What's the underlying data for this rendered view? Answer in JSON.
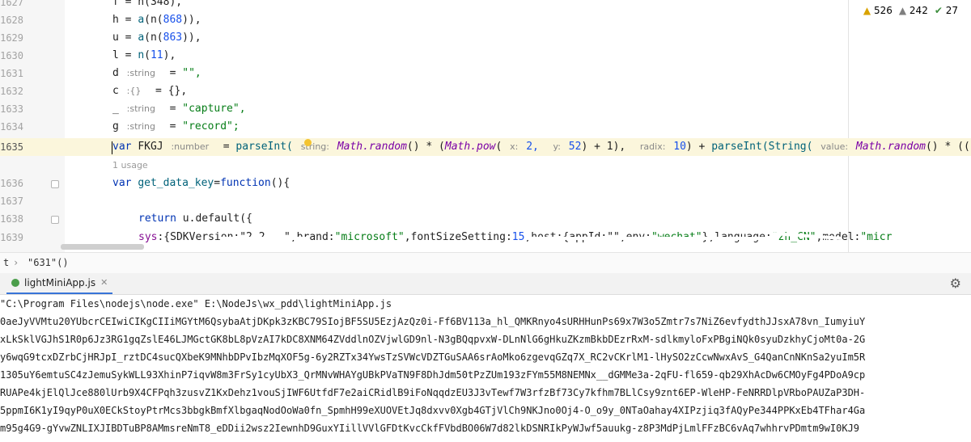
{
  "editor": {
    "lines": {
      "l1627": {
        "num": "1627",
        "text": "f = n(348),"
      },
      "l1628": {
        "num": "1628",
        "var": "h",
        "call": "a",
        "arg": "868"
      },
      "l1629": {
        "num": "1629",
        "var": "u",
        "call": "a",
        "arg": "863"
      },
      "l1630": {
        "num": "1630",
        "var": "l",
        "call": "n",
        "arg": "11"
      },
      "l1631": {
        "num": "1631",
        "var": "d",
        "hint": "string",
        "value": "\"\","
      },
      "l1632": {
        "num": "1632",
        "var": "c",
        "hint": "{}",
        "value": "{},"
      },
      "l1633": {
        "num": "1633",
        "var": "_",
        "hint": "string",
        "value": "\"capture\","
      },
      "l1634": {
        "num": "1634",
        "var": "g",
        "hint": "string",
        "value": "\"record\";"
      },
      "l1635": {
        "num": "1635",
        "kw": "var",
        "name": "FKGJ",
        "hint": "number",
        "fn_parse": "parseInt(",
        "hint_string": "string:",
        "math_random": "Math.random",
        "paren_mul": "() * (",
        "math_pow": "Math.pow",
        "open": "(",
        "hint_x": "x:",
        "x_val": "2,",
        "hint_y": "y:",
        "y_val": "52",
        "tail1": ") + 1),",
        "hint_radix": "radix:",
        "radix_val": "10",
        "tail2": ") + ",
        "fn_parse2": "parseInt(",
        "fn_string": "String(",
        "hint_value": "value:",
        "math_random2": "Math.random",
        "tail3": "() * (("
      },
      "usage": "1 usage",
      "l1636": {
        "num": "1636",
        "kw": "var",
        "name": "get_data_key",
        "rest": "=",
        "fn_kw": "function",
        "tail": "(){"
      },
      "l1637": {
        "num": "1637"
      },
      "l1638": {
        "num": "1638",
        "kw": "return",
        "rest": "u.default({"
      },
      "l1639": {
        "num": "1639",
        "prop": "sys",
        "t1": ":{SDKVersion:",
        "t2": "\"2.2...\",brand:",
        "s_brand": "\"microsoft\"",
        "t3": ",fontSizeSetting:",
        "n_font": "15",
        "t4": ",host:{appId:",
        "t5": "\"\",env:",
        "s_env": "\"wechat\"",
        "t6": "},language:",
        "s_lang": "\"zh_CN\"",
        "t7": ",model:",
        "s_model": "\"micr"
      }
    },
    "inspections": {
      "warnings": "526",
      "weak": "242",
      "ok": "27"
    }
  },
  "breadcrumb": {
    "scope": "t",
    "item": "\"631\"()"
  },
  "run_panel": {
    "tab_label": "lightMiniApp.js",
    "console": [
      "\"C:\\Program Files\\nodejs\\node.exe\" E:\\NodeJs\\wx_pdd\\lightMiniApp.js",
      "0aeJyVVMtu20YUbcrCEIwiCIKgCIIiMGYtM6QsybaAtjDKpk3zKBC79SIojBF5SU5EzjAzQz0i-Ff6BV113a_hl_QMKRnyo4sURHHunPs69x7W3o5Zmtr7s7NiZ6evfydthJJsxA78vn_IumyiuY",
      "xLkSklVGJhS1R0p6Jz3RG1gqZslE46LJMGctGK8bL8pVzAI7kDC8XNM64ZVddlnOZVjwlGD9nl-N3gBQqpvxW-DLnNlG6gHkuZKzmBkbDEzrRxM-sdlkmyloFxPBgiNQk0syuDzkhyCjoMt0a-2G",
      "y6wqG9tcxDZrbCjHRJpI_rztDC4sucQXbeK9MNhbDPvIbzMqXOF5g-6y2RZTx34YwsTzSVWcVDZTGuSAA6srAoMko6zgevqGZq7X_RC2vCKrlM1-lHySO2zCcwNwxAvS_G4QanCnNKnSa2yuIm5R",
      "1305uY6emtuSC4zJemuSykWLL93XhinP7iqvW8m3FrSy1cyUbX3_QrMNvWHAYgUBkPVaTN9F8DhJdm50tPzZUm193zFYm55M8NEMNx__dGMMe3a-2qFU-fl659-qb29XhAcDw6CMOyFg4PDoA9cp",
      "RUAPe4kjElQlJce880lUrb9X4CFPqh3zusvZ1KxDehz1vouSjIWF6UtfdF7e2aiCRidlB9iFoNqqdzEU3J3vTewf7W3rfzBf73Cy7kfhm7BLlCsy9znt6EP-WleHP-FeNRRDlpVRboPAUZaP3DH-",
      "5ppmI6K1yI9qyP0uX0ECkStoyPtrMcs3bbgkBmfXlbgaqNodOoWa0fn_SpmhH99eXUOVEtJq8dxvv0Xgb4GTjVlCh9NKJno0Oj4-O_o9y_0NTaOahay4XIPzjiq3fAQyPe344PPKxEb4TFhar4Ga",
      "m95g4G9-gYvwZNLIXJIBDTuBP8AMmsreNmT8_eDDii2wsz2IewnhD9GuxYIillVVlGFDtKvcCkfFVbdBO06W7d82lkDSNRIkPyWJwf5auukg-z8P3MdPjLmlFFzBC6vAq7whhrvPDmtm9wI0KJ9"
    ]
  },
  "colors": {
    "keyword": "#0033b3",
    "string": "#067d17",
    "number": "#1750eb",
    "function": "#00627a",
    "tab_accent": "#3874d8",
    "warning": "#d9a300"
  }
}
